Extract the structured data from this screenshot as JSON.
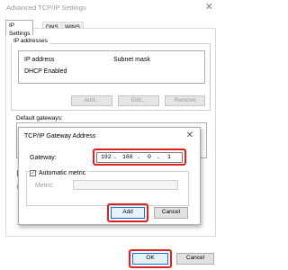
{
  "window": {
    "title": "Advanced TCP/IP Settings",
    "close_glyph": "✕"
  },
  "tabs": [
    {
      "label": "IP Settings"
    },
    {
      "label": "DNS"
    },
    {
      "label": "WINS"
    }
  ],
  "ip_addresses": {
    "heading": "IP addresses",
    "columns": [
      "IP address",
      "Subnet mask"
    ],
    "rows": [
      {
        "ip": "DHCP Enabled",
        "mask": ""
      }
    ],
    "buttons": {
      "add": "Add...",
      "edit": "Edit...",
      "remove": "Remove"
    }
  },
  "default_gateways": {
    "heading": "Default gateways:"
  },
  "left_clip": {
    "text": "In"
  },
  "dialog": {
    "title": "TCP/IP Gateway Address",
    "close_glyph": "✕",
    "gateway_label": "Gateway:",
    "gateway_octets": [
      "192",
      "168",
      "0",
      "1"
    ],
    "automatic_metric_label": "Automatic metric",
    "automatic_metric_checked": true,
    "metric_label": "Metric:",
    "metric_value": "",
    "add_label": "Add",
    "cancel_label": "Cancel"
  },
  "footer": {
    "ok_label": "OK",
    "cancel_label": "Cancel"
  },
  "colors": {
    "highlight": "#e02020",
    "accent": "#0078d7"
  }
}
